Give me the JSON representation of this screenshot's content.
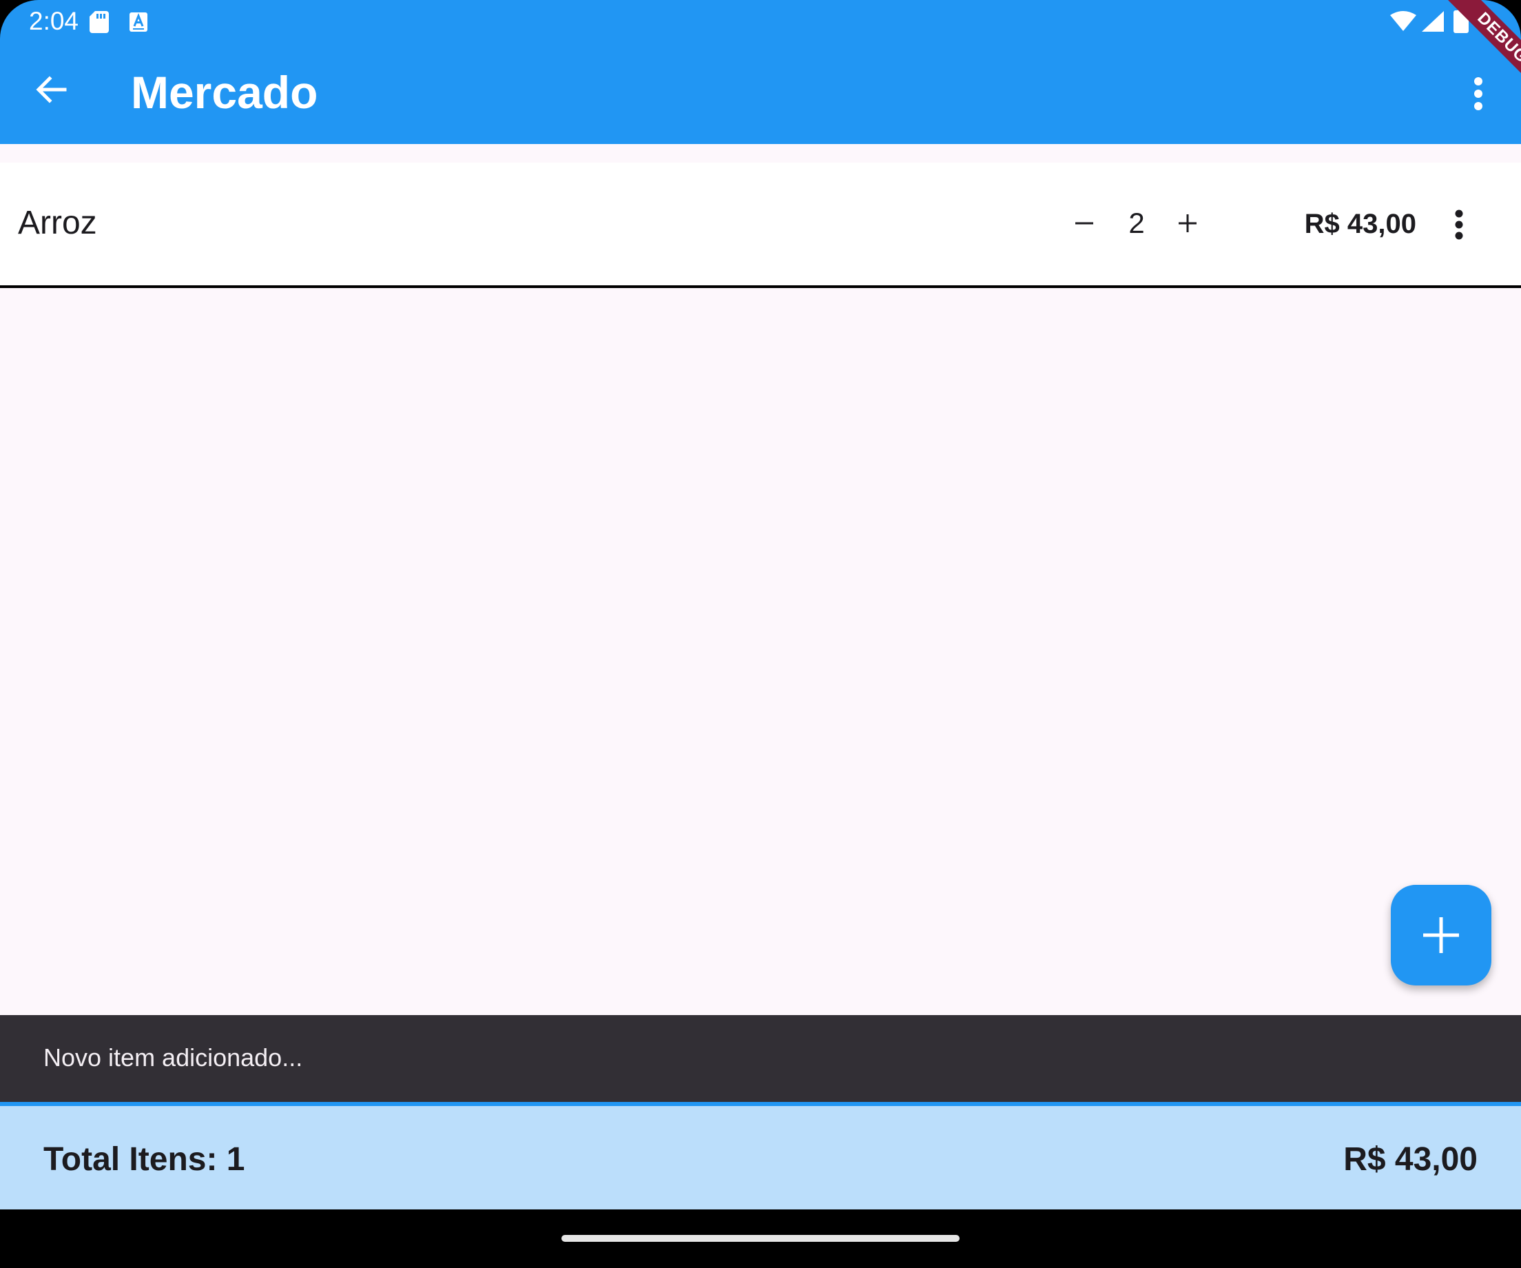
{
  "status_bar": {
    "time": "2:04",
    "icons": [
      "sd-card-icon",
      "font-a-icon",
      "wifi-icon",
      "cell-signal-icon",
      "battery-icon"
    ]
  },
  "debug_banner": {
    "label": "DEBUG",
    "color": "#8B1A3A"
  },
  "toolbar": {
    "title": "Mercado",
    "back_icon": "arrow-back-icon",
    "more_icon": "more-vert-icon",
    "color": "#2196F3"
  },
  "items": [
    {
      "name": "Arroz",
      "quantity": "2",
      "price": "R$ 43,00"
    }
  ],
  "fab": {
    "icon": "add-icon",
    "color": "#2196F3"
  },
  "snackbar": {
    "message": "Novo item adicionado..."
  },
  "footer": {
    "total_label": "Total Itens: 1",
    "total_value": "R$ 43,00",
    "background": "#BBDEFB"
  },
  "colors": {
    "content_background": "#FDF7FC",
    "snackbar_background": "#322F35"
  }
}
